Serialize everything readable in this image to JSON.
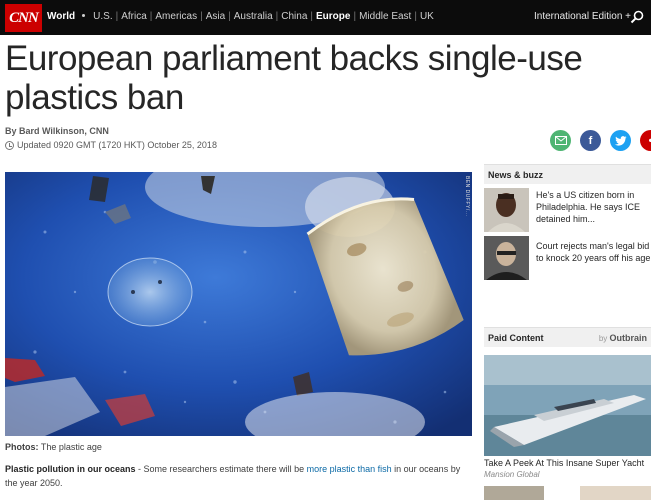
{
  "header": {
    "logo": "CNN",
    "nav_first": "World",
    "nav_items": [
      "U.S.",
      "Africa",
      "Americas",
      "Asia",
      "Australia",
      "China",
      "Europe",
      "Middle East",
      "UK"
    ],
    "active_item": "Europe",
    "edition": "International Edition +"
  },
  "article": {
    "headline": "European parliament backs single-use plastics ban",
    "byline": "By Bard Wilkinson, CNN",
    "updated": "Updated 0920 GMT (1720 HKT) October 25, 2018",
    "image_credit": "BEN DUFFY/...",
    "photo_label": "Photos:",
    "photo_source": "The plastic age",
    "caption_title": "Plastic pollution in our oceans",
    "caption_dash": " - Some researchers estimate there will be ",
    "caption_link": "more plastic than fish",
    "caption_end": " in our oceans by the year 2050."
  },
  "rail": {
    "news_header": "News & buzz",
    "news": [
      {
        "lines": [
          "He's a US citizen born in",
          "Philadelphia. He says ICE",
          "detained him..."
        ]
      },
      {
        "lines": [
          "Court rejects man's legal bid",
          "to knock 20 years off his age"
        ]
      }
    ],
    "paid_header": "Paid Content",
    "outbrain_by": "by",
    "outbrain_brand": "Outbrain",
    "paid_title": "Take A Peek At This Insane Super Yacht",
    "paid_source": "Mansion Global"
  },
  "colors": {
    "cnn_red": "#cc0000",
    "topbar": "#0c0c0c",
    "link": "#0c6aa6"
  }
}
